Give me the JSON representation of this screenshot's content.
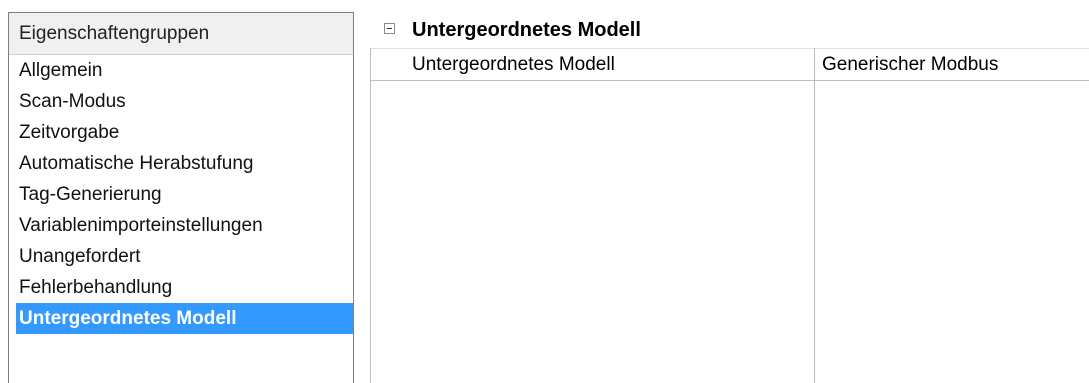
{
  "groups": {
    "header": "Eigenschaftengruppen",
    "items": [
      {
        "label": "Allgemein"
      },
      {
        "label": "Scan-Modus"
      },
      {
        "label": "Zeitvorgabe"
      },
      {
        "label": "Automatische Herabstufung"
      },
      {
        "label": "Tag-Generierung"
      },
      {
        "label": "Variablenimporteinstellungen"
      },
      {
        "label": "Unangefordert"
      },
      {
        "label": "Fehlerbehandlung"
      },
      {
        "label": "Untergeordnetes Modell",
        "selected": true
      }
    ]
  },
  "grid": {
    "category_title": "Untergeordnetes Modell",
    "properties": [
      {
        "name": "Untergeordnetes Modell",
        "value": "Generischer Modbus"
      }
    ]
  },
  "colors": {
    "selection": "#3399ff",
    "header_bg": "#f0f0f0"
  }
}
